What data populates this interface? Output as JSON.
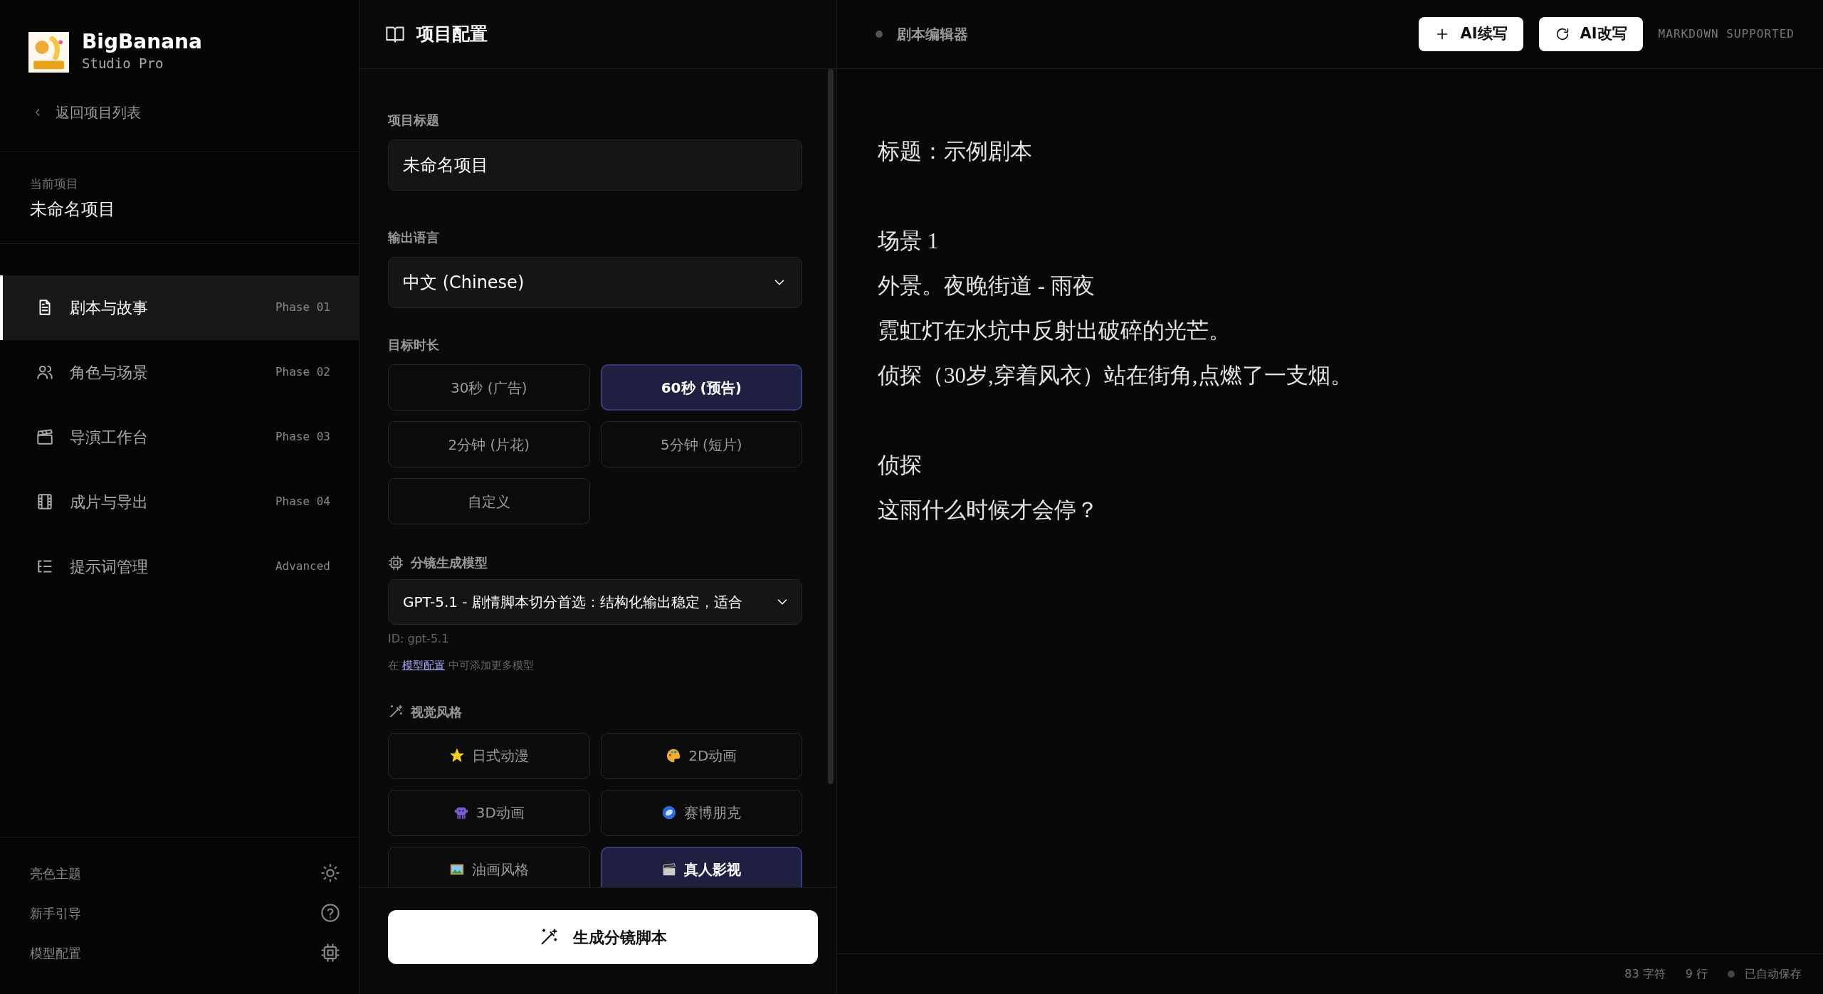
{
  "sidebar": {
    "brand": {
      "name": "BigBanana",
      "subtitle": "Studio Pro"
    },
    "back_link": "返回项目列表",
    "current_project": {
      "label": "当前项目",
      "name": "未命名项目"
    },
    "nav_items": [
      {
        "label": "剧本与故事",
        "tag": "Phase 01",
        "selected": true
      },
      {
        "label": "角色与场景",
        "tag": "Phase 02",
        "selected": false
      },
      {
        "label": "导演工作台",
        "tag": "Phase 03",
        "selected": false
      },
      {
        "label": "成片与导出",
        "tag": "Phase 04",
        "selected": false
      },
      {
        "label": "提示词管理",
        "tag": "Advanced",
        "selected": false
      }
    ],
    "footer_items": [
      {
        "label": "亮色主题"
      },
      {
        "label": "新手引导"
      },
      {
        "label": "模型配置"
      }
    ]
  },
  "config_panel": {
    "title": "项目配置",
    "project_title": {
      "label": "项目标题",
      "value": "未命名项目"
    },
    "language": {
      "label": "输出语言",
      "value": "中文 (Chinese)"
    },
    "duration": {
      "label": "目标时长",
      "options": [
        {
          "label": "30秒 (广告)",
          "selected": false
        },
        {
          "label": "60秒 (预告)",
          "selected": true
        },
        {
          "label": "2分钟 (片花)",
          "selected": false
        },
        {
          "label": "5分钟 (短片)",
          "selected": false
        },
        {
          "label": "自定义",
          "selected": false
        }
      ]
    },
    "model": {
      "label": "分镜生成模型",
      "value": "GPT-5.1 - 剧情脚本切分首选：结构化输出稳定，适合",
      "id_note": "ID: gpt-5.1",
      "hint": {
        "before": "在",
        "link": "模型配置",
        "after": "中可添加更多模型"
      }
    },
    "style": {
      "label": "视觉风格",
      "options": [
        {
          "label": "日式动漫",
          "selected": false
        },
        {
          "label": "2D动画",
          "selected": false
        },
        {
          "label": "3D动画",
          "selected": false
        },
        {
          "label": "赛博朋克",
          "selected": false
        },
        {
          "label": "油画风格",
          "selected": false
        },
        {
          "label": "真人影视",
          "selected": true
        }
      ]
    },
    "generate_button": "生成分镜脚本"
  },
  "editor": {
    "title": "剧本编辑器",
    "buttons": [
      "AI续写",
      "AI改写"
    ],
    "badge": "MARKDOWN SUPPORTED",
    "blocks": [
      [
        "标题：示例剧本"
      ],
      [
        "场景 1",
        "外景。夜晚街道 - 雨夜",
        "霓虹灯在水坑中反射出破碎的光芒。",
        "侦探（30岁,穿着风衣）站在街角,点燃了一支烟。"
      ],
      [
        "侦探",
        "这雨什么时候才会停？"
      ]
    ],
    "status": {
      "chars": "83 字符",
      "lines": "9 行",
      "save_state": "已自动保存"
    }
  }
}
